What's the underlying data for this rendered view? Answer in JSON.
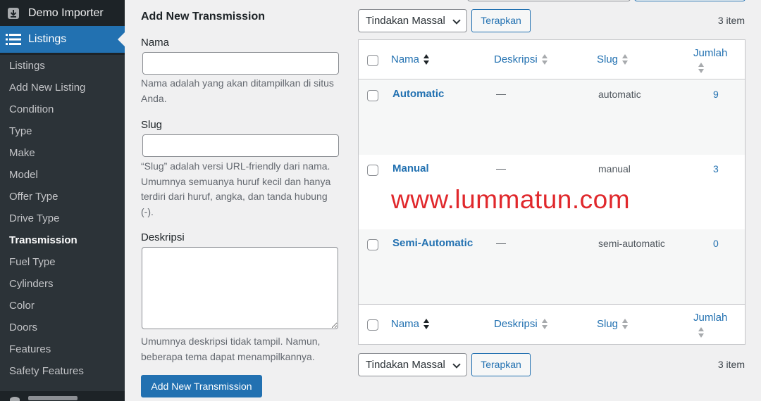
{
  "sidebar": {
    "demo_importer": "Demo Importer",
    "listings": "Listings",
    "items": [
      {
        "label": "Listings"
      },
      {
        "label": "Add New Listing"
      },
      {
        "label": "Condition"
      },
      {
        "label": "Type"
      },
      {
        "label": "Make"
      },
      {
        "label": "Model"
      },
      {
        "label": "Offer Type"
      },
      {
        "label": "Drive Type"
      },
      {
        "label": "Transmission",
        "current": true
      },
      {
        "label": "Fuel Type"
      },
      {
        "label": "Cylinders"
      },
      {
        "label": "Color"
      },
      {
        "label": "Doors"
      },
      {
        "label": "Features"
      },
      {
        "label": "Safety Features"
      }
    ]
  },
  "form": {
    "title": "Add New Transmission",
    "name_label": "Nama",
    "name_value": "",
    "name_help": "Nama adalah yang akan ditampilkan di situs Anda.",
    "slug_label": "Slug",
    "slug_value": "",
    "slug_help": "“Slug” adalah versi URL-friendly dari nama. Umumnya semuanya huruf kecil dan hanya terdiri dari huruf, angka, dan tanda hubung (-).",
    "desc_label": "Deskripsi",
    "desc_value": "",
    "desc_help": "Umumnya deskripsi tidak tampil. Namun, beberapa tema dapat menampilkannya.",
    "submit_label": "Add New Transmission"
  },
  "bulk": {
    "select_label": "Tindakan Massal",
    "apply_label": "Terapkan",
    "items_count": "3 item"
  },
  "table": {
    "columns": {
      "name": "Nama",
      "desc": "Deskripsi",
      "slug": "Slug",
      "count": "Jumlah"
    },
    "rows": [
      {
        "name": "Automatic",
        "desc": "—",
        "slug": "automatic",
        "count": "9"
      },
      {
        "name": "Manual",
        "desc": "—",
        "slug": "manual",
        "count": "3"
      },
      {
        "name": "Semi-Automatic",
        "desc": "—",
        "slug": "semi-automatic",
        "count": "0"
      }
    ]
  },
  "watermark": "www.lummatun.com",
  "colors": {
    "accent": "#2271b1",
    "sidebar": "#1d2327",
    "watermark": "#e0282c"
  }
}
